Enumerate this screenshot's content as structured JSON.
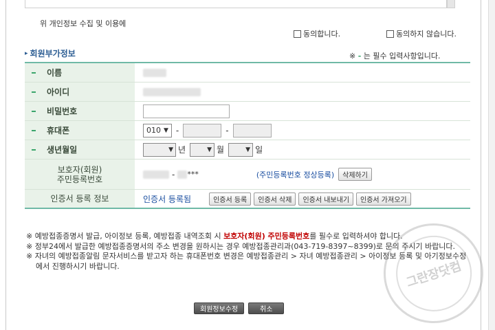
{
  "top_box": {
    "text": ""
  },
  "consent": {
    "question": "위 개인정보 수집 및 이용에",
    "agree_label": "동의합니다.",
    "disagree_label": "동의하지 않습니다."
  },
  "section": {
    "title": "회원부가정보",
    "required_note_prefix": "※",
    "required_note_mark": "-",
    "required_note_suffix": "는 필수 입력사항입니다."
  },
  "fields": {
    "name_label": "이름",
    "id_label": "아이디",
    "password_label": "비밀번호",
    "phone_label": "휴대폰",
    "phone_prefix_value": "010",
    "phone_sep1": "-",
    "phone_sep2": "-",
    "birth_label": "생년월일",
    "birth_year_unit": "년",
    "birth_month_unit": "월",
    "birth_day_unit": "일",
    "guardian_label_line1": "보호자(회원)",
    "guardian_label_line2": "주민등록번호",
    "guardian_sep": "-",
    "guardian_mask": "***",
    "guardian_status": "(주민등록번호 정상등록)",
    "guardian_delete_button": "삭제하기",
    "cert_label": "인증서 등록 정보",
    "cert_status": "인증서 등록됨",
    "cert_buttons": [
      "인증서 등록",
      "인증서 삭제",
      "인증서 내보내기",
      "인증서 가져오기"
    ]
  },
  "notes": {
    "n1_pre": "※ 예방접종증명서 발급, 아이정보 등록, 예방접종 내역조회 시 ",
    "n1_bold": "보호자(회원) 주민등록번호",
    "n1_post": "를 필수로 입력하셔야 합니다.",
    "n2": "※ 정부24에서 발급한 예방접종증명서의 주소 변경을 원하시는 경우 예방접종관리과(043-719-8397~8399)로 문의 주시기 바랍니다.",
    "n3": "※ 자녀의 예방접종알림 문자서비스를 받고자 하는 휴대폰번호 변경은 예방접종관리 > 자녀 예방접종관리 > 아이정보 등록 및 아기정보수정에서 진행하시기 바랍니다."
  },
  "buttons": {
    "save": "회원정보수정",
    "cancel": "취소"
  },
  "watermark": {
    "text": "그란장닷컴"
  },
  "colors": {
    "accent_green": "#6fb9a6",
    "label_bg": "#e9f2e9",
    "section_blue": "#2c5d93",
    "required_red": "#c00000"
  }
}
